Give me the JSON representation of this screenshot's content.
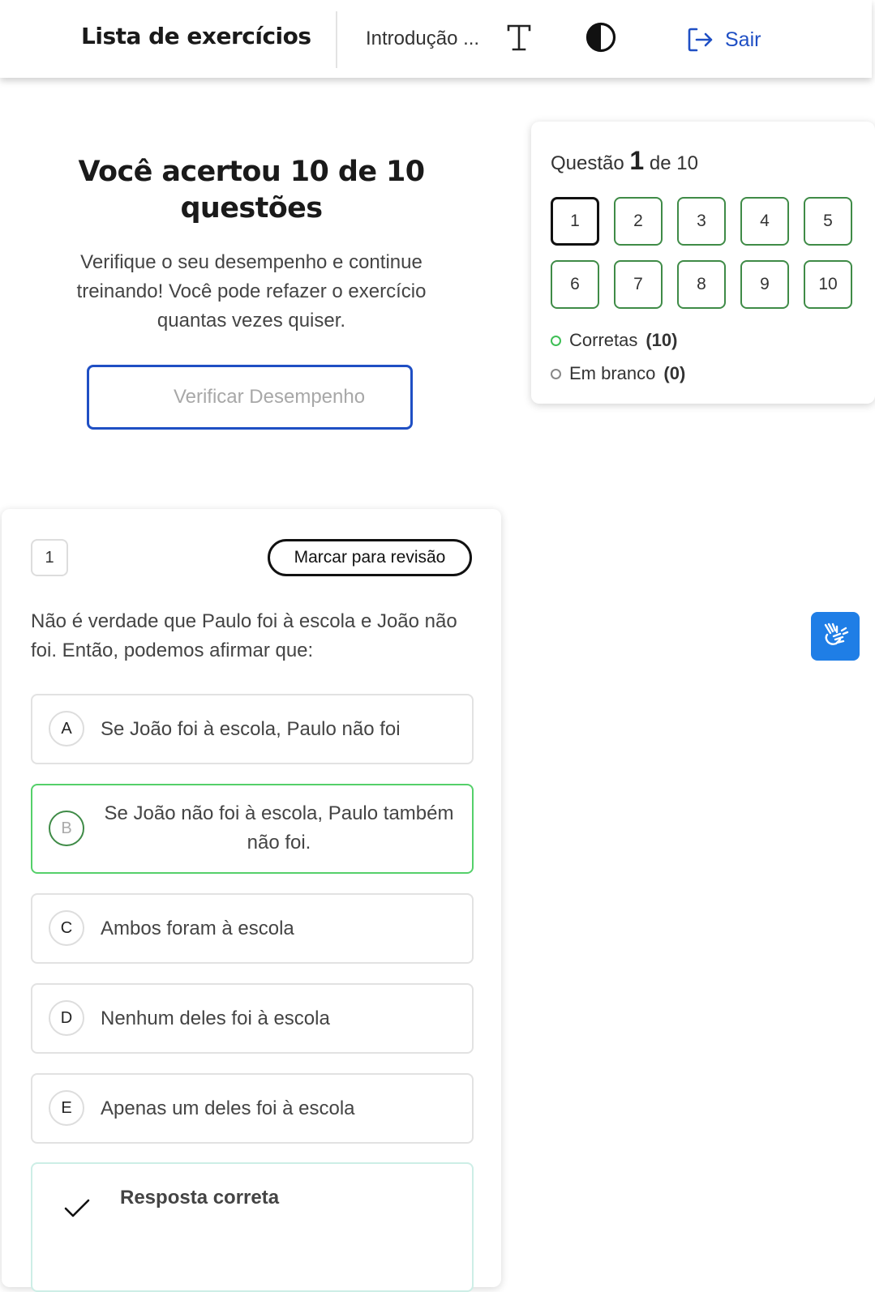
{
  "header": {
    "app_title": "Lista de exercícios",
    "course_title": "Introdução ...",
    "font_size_icon": "text-size-icon",
    "contrast_icon": "contrast-icon",
    "exit_label": "Sair",
    "accent_color": "#1f4fc4"
  },
  "result": {
    "title": "Você acertou 10 de 10 questões",
    "description": "Verifique o seu desempenho e continue treinando! Você pode refazer o exercício quantas vezes quiser.",
    "button_label": "Verificar Desempenho"
  },
  "navigator": {
    "prefix": "Questão",
    "current": "1",
    "suffix": "de 10",
    "questions": [
      "1",
      "2",
      "3",
      "4",
      "5",
      "6",
      "7",
      "8",
      "9",
      "10"
    ],
    "correct_color": "#3f8b47",
    "legend": {
      "correct_label": "Corretas",
      "correct_count": "(10)",
      "blank_label": "Em branco",
      "blank_count": "(0)"
    }
  },
  "question": {
    "number": "1",
    "review_button": "Marcar para revisão",
    "text": "Não é verdade que Paulo foi à escola e João não foi. Então, podemos afirmar que:",
    "options": [
      {
        "letter": "A",
        "text": "Se João foi à escola, Paulo não foi"
      },
      {
        "letter": "B",
        "text": "Se João não foi à escola, Paulo também não foi."
      },
      {
        "letter": "C",
        "text": "Ambos foram à escola"
      },
      {
        "letter": "D",
        "text": "Nenhum deles foi à escola"
      },
      {
        "letter": "E",
        "text": "Apenas um deles foi à escola"
      }
    ],
    "selected_option": "B",
    "answer_label": "Resposta correta"
  },
  "accessibility": {
    "icon": "sign-language-icon",
    "color": "#1f7ee6"
  }
}
